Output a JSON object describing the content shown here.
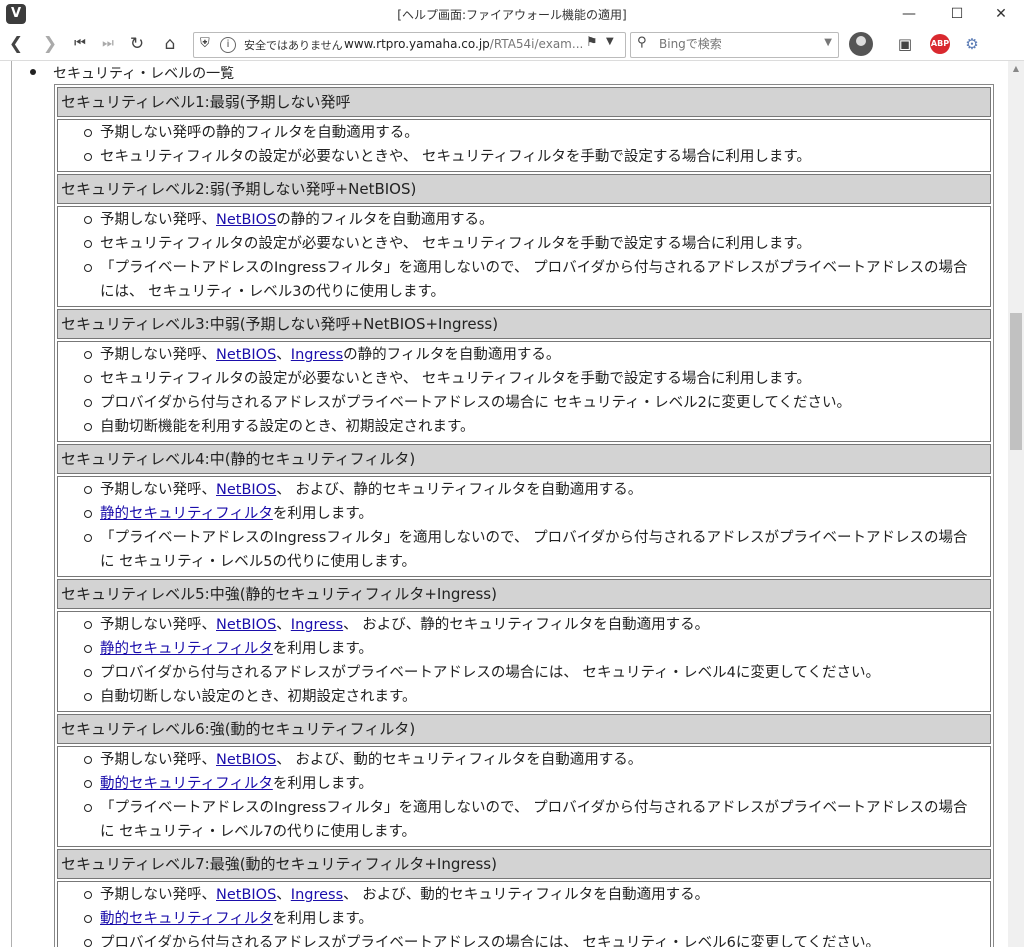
{
  "window": {
    "title": "[ヘルプ画面:ファイアウォール機能の適用]",
    "app_icon": "V"
  },
  "toolbar": {
    "insecure_label": "安全ではありません",
    "url_host": "www.rtpro.yamaha.co.jp",
    "url_path": "/RTA54i/exam...",
    "search_placeholder": "Bingで検索",
    "abp_label": "ABP"
  },
  "page": {
    "heading": "セキュリティ・レベルの一覧",
    "levels": [
      {
        "title": "セキュリティレベル1:最弱(予期しない発呼",
        "items": [
          [
            {
              "t": "予期しない発呼の静的フィルタを自動適用する。"
            }
          ],
          [
            {
              "t": "セキュリティフィルタの設定が必要ないときや、 セキュリティフィルタを手動で設定する場合に利用します。"
            }
          ]
        ]
      },
      {
        "title": "セキュリティレベル2:弱(予期しない発呼+NetBIOS)",
        "items": [
          [
            {
              "t": "予期しない発呼、"
            },
            {
              "t": "NetBIOS",
              "link": true
            },
            {
              "t": "の静的フィルタを自動適用する。"
            }
          ],
          [
            {
              "t": "セキュリティフィルタの設定が必要ないときや、 セキュリティフィルタを手動で設定する場合に利用します。"
            }
          ],
          [
            {
              "t": "「プライベートアドレスのIngressフィルタ」を適用しないので、 プロバイダから付与されるアドレスがプライベートアドレスの場合には、 セキュリティ・レベル3の代りに使用します。"
            }
          ]
        ]
      },
      {
        "title": "セキュリティレベル3:中弱(予期しない発呼+NetBIOS+Ingress)",
        "items": [
          [
            {
              "t": "予期しない発呼、"
            },
            {
              "t": "NetBIOS",
              "link": true
            },
            {
              "t": "、"
            },
            {
              "t": "Ingress",
              "link": true
            },
            {
              "t": "の静的フィルタを自動適用する。"
            }
          ],
          [
            {
              "t": "セキュリティフィルタの設定が必要ないときや、 セキュリティフィルタを手動で設定する場合に利用します。"
            }
          ],
          [
            {
              "t": "プロバイダから付与されるアドレスがプライベートアドレスの場合に セキュリティ・レベル2に変更してください。"
            }
          ],
          [
            {
              "t": "自動切断機能を利用する設定のとき、初期設定されます。"
            }
          ]
        ]
      },
      {
        "title": "セキュリティレベル4:中(静的セキュリティフィルタ)",
        "items": [
          [
            {
              "t": "予期しない発呼、"
            },
            {
              "t": "NetBIOS",
              "link": true
            },
            {
              "t": "、 および、静的セキュリティフィルタを自動適用する。"
            }
          ],
          [
            {
              "t": "静的セキュリティフィルタ",
              "link": true
            },
            {
              "t": "を利用します。"
            }
          ],
          [
            {
              "t": "「プライベートアドレスのIngressフィルタ」を適用しないので、 プロバイダから付与されるアドレスがプライベートアドレスの場合に セキュリティ・レベル5の代りに使用します。"
            }
          ]
        ]
      },
      {
        "title": "セキュリティレベル5:中強(静的セキュリティフィルタ+Ingress)",
        "items": [
          [
            {
              "t": "予期しない発呼、"
            },
            {
              "t": "NetBIOS",
              "link": true
            },
            {
              "t": "、"
            },
            {
              "t": "Ingress",
              "link": true
            },
            {
              "t": "、 および、静的セキュリティフィルタを自動適用する。"
            }
          ],
          [
            {
              "t": "静的セキュリティフィルタ",
              "link": true
            },
            {
              "t": "を利用します。"
            }
          ],
          [
            {
              "t": "プロバイダから付与されるアドレスがプライベートアドレスの場合には、 セキュリティ・レベル4に変更してください。"
            }
          ],
          [
            {
              "t": "自動切断しない設定のとき、初期設定されます。"
            }
          ]
        ]
      },
      {
        "title": "セキュリティレベル6:強(動的セキュリティフィルタ)",
        "items": [
          [
            {
              "t": "予期しない発呼、"
            },
            {
              "t": "NetBIOS",
              "link": true
            },
            {
              "t": "、 および、動的セキュリティフィルタを自動適用する。"
            }
          ],
          [
            {
              "t": "動的セキュリティフィルタ",
              "link": true
            },
            {
              "t": "を利用します。"
            }
          ],
          [
            {
              "t": "「プライベートアドレスのIngressフィルタ」を適用しないので、 プロバイダから付与されるアドレスがプライベートアドレスの場合に セキュリティ・レベル7の代りに使用します。"
            }
          ]
        ]
      },
      {
        "title": "セキュリティレベル7:最強(動的セキュリティフィルタ+Ingress)",
        "items": [
          [
            {
              "t": "予期しない発呼、"
            },
            {
              "t": "NetBIOS",
              "link": true
            },
            {
              "t": "、"
            },
            {
              "t": "Ingress",
              "link": true
            },
            {
              "t": "、 および、動的セキュリティフィルタを自動適用する。"
            }
          ],
          [
            {
              "t": "動的セキュリティフィルタ",
              "link": true
            },
            {
              "t": "を利用します。"
            }
          ],
          [
            {
              "t": "プロバイダから付与されるアドレスがプライベートアドレスの場合には、 セキュリティ・レベル6に変更してください。"
            }
          ]
        ]
      }
    ]
  }
}
